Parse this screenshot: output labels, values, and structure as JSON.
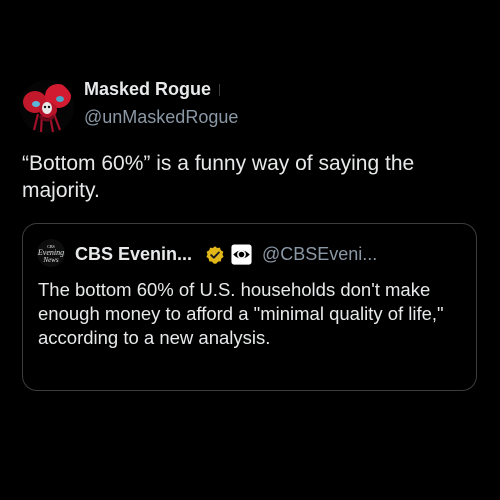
{
  "tweet": {
    "author_name": "Masked Rogue",
    "author_handle": "@unMaskedRogue",
    "text": "“Bottom 60%” is a funny way of saying the majority."
  },
  "quoted_tweet": {
    "logo_text": {
      "line1": "CBS",
      "line2": "Evening",
      "line3": "News"
    },
    "author_name": "CBS Evenin...",
    "author_handle": "@CBSEveni...",
    "text": "The bottom 60% of U.S. households don't make enough money to afford a \"minimal quality of life,\" according to a new analysis.",
    "verified_color": "#e2b719"
  },
  "icons": {
    "avatar": "masked-figure-avatar",
    "verified": "gold-verified-badge-icon",
    "affiliate": "cbs-eye-affiliate-icon"
  },
  "colors": {
    "background": "#000000",
    "primary_text": "#e7e9ea",
    "secondary_text": "#8b98a5",
    "card_border": "#3a3d40"
  }
}
